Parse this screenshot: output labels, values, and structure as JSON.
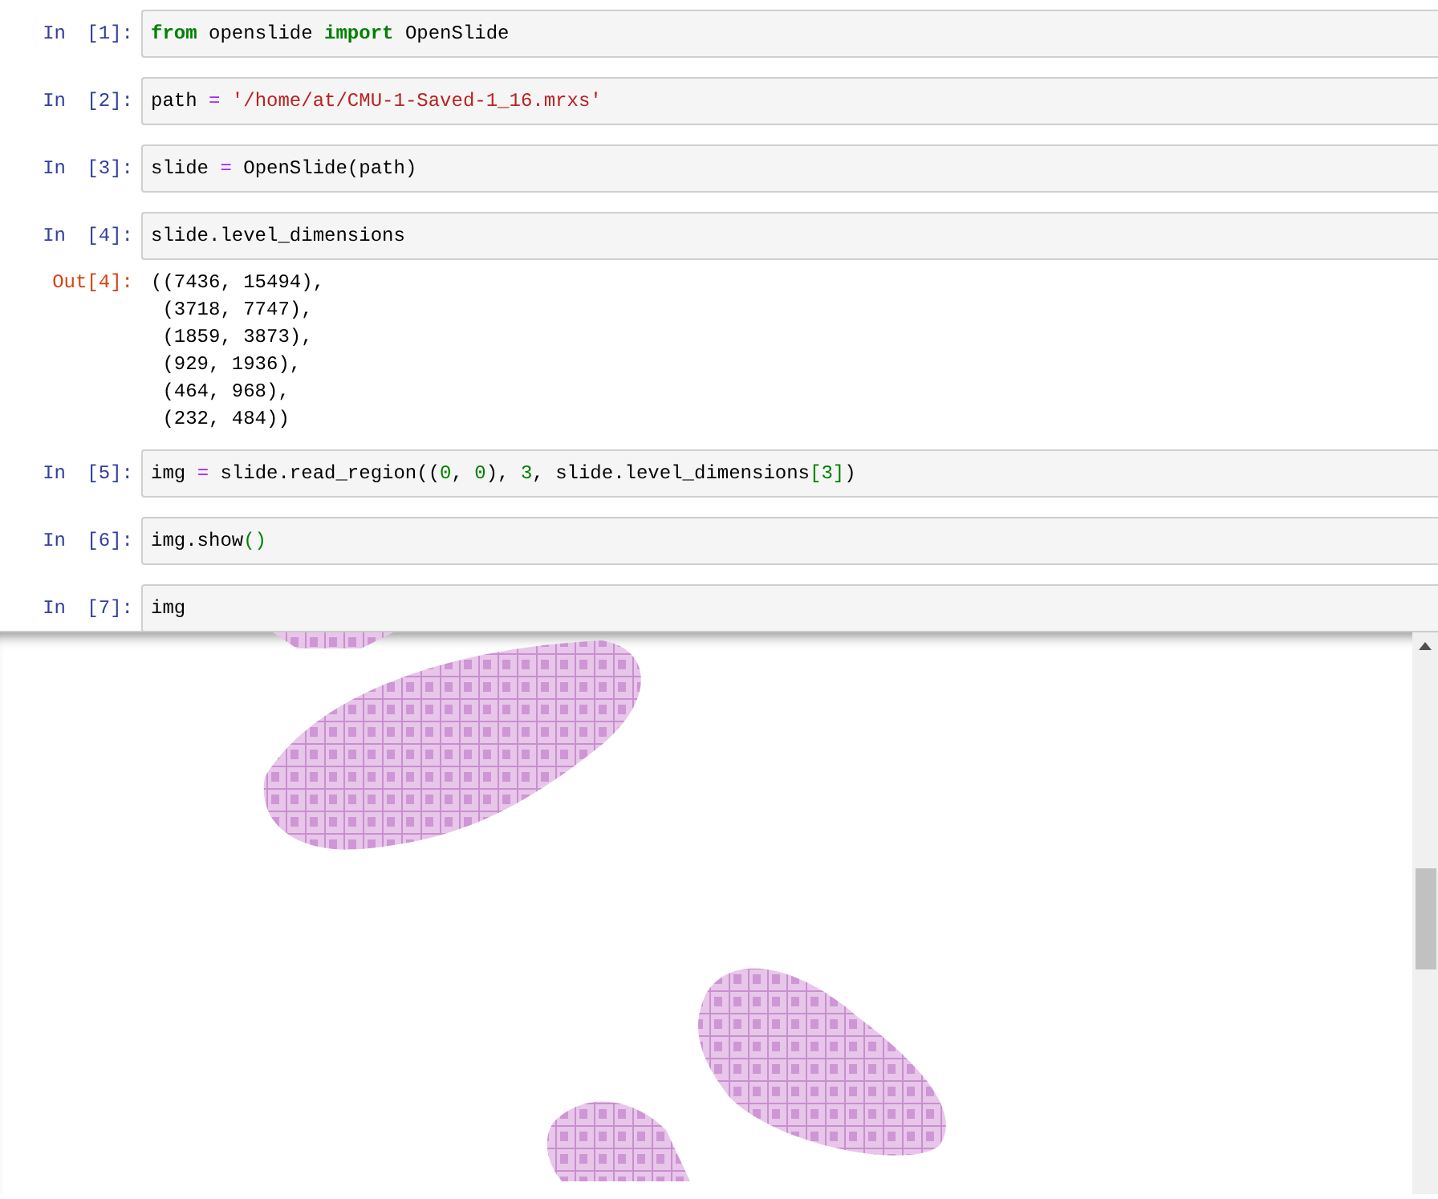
{
  "cells": [
    {
      "kind": "code",
      "prompt": "In [1]:",
      "tokens": [
        {
          "kind": "keyword",
          "text": "from"
        },
        {
          "kind": "plain",
          "text": " openslide "
        },
        {
          "kind": "keyword",
          "text": "import"
        },
        {
          "kind": "plain",
          "text": " OpenSlide"
        }
      ]
    },
    {
      "kind": "code",
      "prompt": "In [2]:",
      "tokens": [
        {
          "kind": "plain",
          "text": "path "
        },
        {
          "kind": "operator",
          "text": "= "
        },
        {
          "kind": "string",
          "text": "'/home/at/CMU-1-Saved-1_16.mrxs'"
        }
      ]
    },
    {
      "kind": "code",
      "prompt": "In [3]:",
      "tokens": [
        {
          "kind": "plain",
          "text": "slide "
        },
        {
          "kind": "operator",
          "text": "="
        },
        {
          "kind": "plain",
          "text": " OpenSlide(path)"
        }
      ]
    },
    {
      "kind": "code",
      "prompt": "In [4]:",
      "tokens": [
        {
          "kind": "plain",
          "text": "slide.level_dimensions"
        }
      ]
    },
    {
      "kind": "output",
      "prompt": "Out[4]:",
      "lines": [
        "((7436, 15494),",
        " (3718, 7747),",
        " (1859, 3873),",
        " (929, 1936),",
        " (464, 968),",
        " (232, 484))"
      ]
    },
    {
      "kind": "code",
      "prompt": "In [5]:",
      "tokens": [
        {
          "kind": "plain",
          "text": "img "
        },
        {
          "kind": "operator",
          "text": "="
        },
        {
          "kind": "plain",
          "text": " slide.read_region(("
        },
        {
          "kind": "number",
          "text": "0"
        },
        {
          "kind": "plain",
          "text": ", "
        },
        {
          "kind": "number",
          "text": "0"
        },
        {
          "kind": "plain",
          "text": "), "
        },
        {
          "kind": "number",
          "text": "3"
        },
        {
          "kind": "plain",
          "text": ", slide.level_dimensions"
        },
        {
          "kind": "bracket",
          "text": "[3]"
        },
        {
          "kind": "plain",
          "text": ")"
        }
      ]
    },
    {
      "kind": "code",
      "prompt": "In [6]:",
      "tokens": [
        {
          "kind": "plain",
          "text": "img.show"
        },
        {
          "kind": "bracket",
          "text": "()"
        }
      ]
    },
    {
      "kind": "code",
      "prompt": "In [7]:",
      "tokens": [
        {
          "kind": "plain",
          "text": "img"
        }
      ]
    },
    {
      "kind": "image"
    }
  ]
}
